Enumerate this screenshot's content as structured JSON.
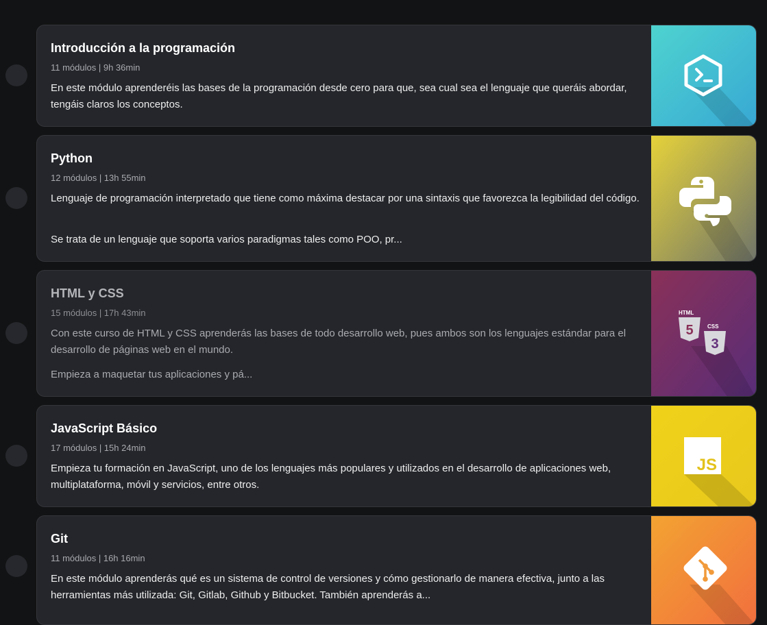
{
  "courses": [
    {
      "title": "Introducción a la programación",
      "meta": "11 módulos | 9h 36min",
      "description": "En este módulo aprenderéis las bases de la programación desde cero para que, sea cual sea el lenguaje que queráis abordar, tengáis claros los conceptos.",
      "description2": "",
      "icon": "terminal-icon",
      "colors": [
        "#4ed3cf",
        "#38a8d4"
      ]
    },
    {
      "title": "Python",
      "meta": "12 módulos | 13h 55min",
      "description": "Lenguaje de programación interpretado que tiene como máxima destacar por una sintaxis que favorezca la legibilidad del código.",
      "description2": "Se trata de un lenguaje que soporta varios paradigmas tales como POO, pr...",
      "icon": "python-icon",
      "colors": [
        "#e6d23a",
        "#70756a"
      ]
    },
    {
      "title": "HTML y CSS",
      "meta": "15 módulos | 17h 43min",
      "description": "Con este curso de HTML y CSS aprenderás las bases de todo desarrollo web, pues ambos son los lenguajes estándar para el desarrollo de páginas web en el mundo.",
      "description2": "Empieza a maquetar tus aplicaciones y pá...",
      "icon": "html-css-icon",
      "icon_labels": [
        "HTML",
        "CSS"
      ],
      "colors": [
        "#8a3158",
        "#582d78"
      ]
    },
    {
      "title": "JavaScript Básico",
      "meta": "17 módulos | 15h 24min",
      "description": "Empieza tu formación en JavaScript, uno de los lenguajes más populares y utilizados en el desarrollo de aplicaciones web, multiplataforma, móvil y servicios, entre otros.",
      "description2": "",
      "icon": "javascript-icon",
      "icon_labels": [
        "JS"
      ],
      "colors": [
        "#f0d21a",
        "#e8c81c"
      ]
    },
    {
      "title": "Git",
      "meta": "11 módulos | 16h 16min",
      "description": "En este módulo aprenderás qué es un sistema de control de versiones y cómo gestionarlo de manera efectiva, junto a las herramientas más utilizada: Git, Gitlab, Github y Bitbucket. También aprenderás a...",
      "description2": "",
      "icon": "git-icon",
      "colors": [
        "#f3a332",
        "#f16f3e"
      ]
    }
  ]
}
